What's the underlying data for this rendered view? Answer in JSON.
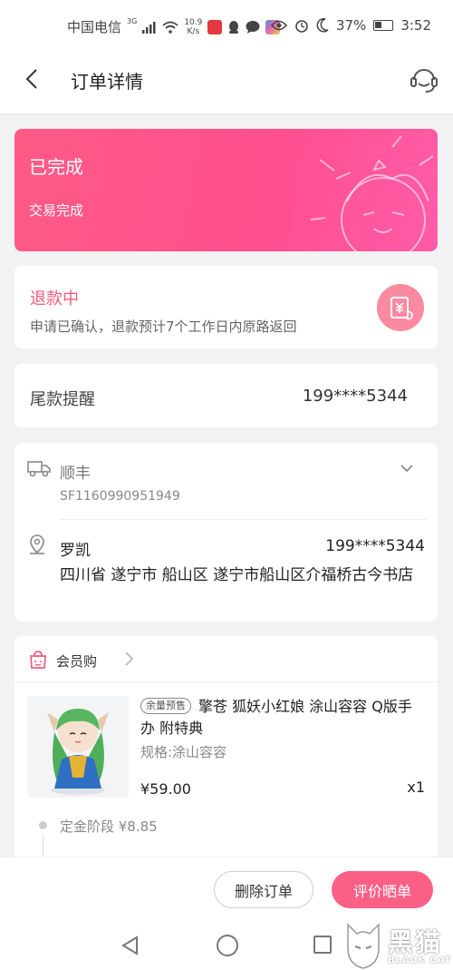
{
  "status_bar": {
    "carrier": "中国电信",
    "network": "3G",
    "speed_value": "10.9",
    "speed_unit": "K/s",
    "battery": "37%",
    "time": "3:52"
  },
  "header": {
    "title": "订单详情"
  },
  "order_status": {
    "title": "已完成",
    "subtitle": "交易完成"
  },
  "refund": {
    "title": "退款中",
    "description": "申请已确认，退款预计7个工作日内原路返回"
  },
  "balance_reminder": {
    "label": "尾款提醒",
    "phone": "199****5344"
  },
  "shipping": {
    "courier": "顺丰",
    "tracking_no": "SF1160990951949",
    "receiver_name": "罗凯",
    "receiver_phone": "199****5344",
    "address": "四川省 遂宁市 船山区 遂宁市船山区介福桥古今书店"
  },
  "product_section": {
    "shop_name": "会员购",
    "presale_tag": "余量预售",
    "title": "擎苍 狐妖小红娘 涂山容容 Q版手办 附特典",
    "spec": "规格:涂山容容",
    "price": "¥59.00",
    "quantity": "x1",
    "stage": "定金阶段  ¥8.85"
  },
  "actions": {
    "delete_label": "删除订单",
    "review_label": "评价晒单"
  },
  "watermark": {
    "text": "黑猫",
    "sub": "BLACK CAT"
  },
  "colors": {
    "accent": "#ff5b86",
    "refund_text": "#f25b7c",
    "review_button": "#fa6085"
  }
}
